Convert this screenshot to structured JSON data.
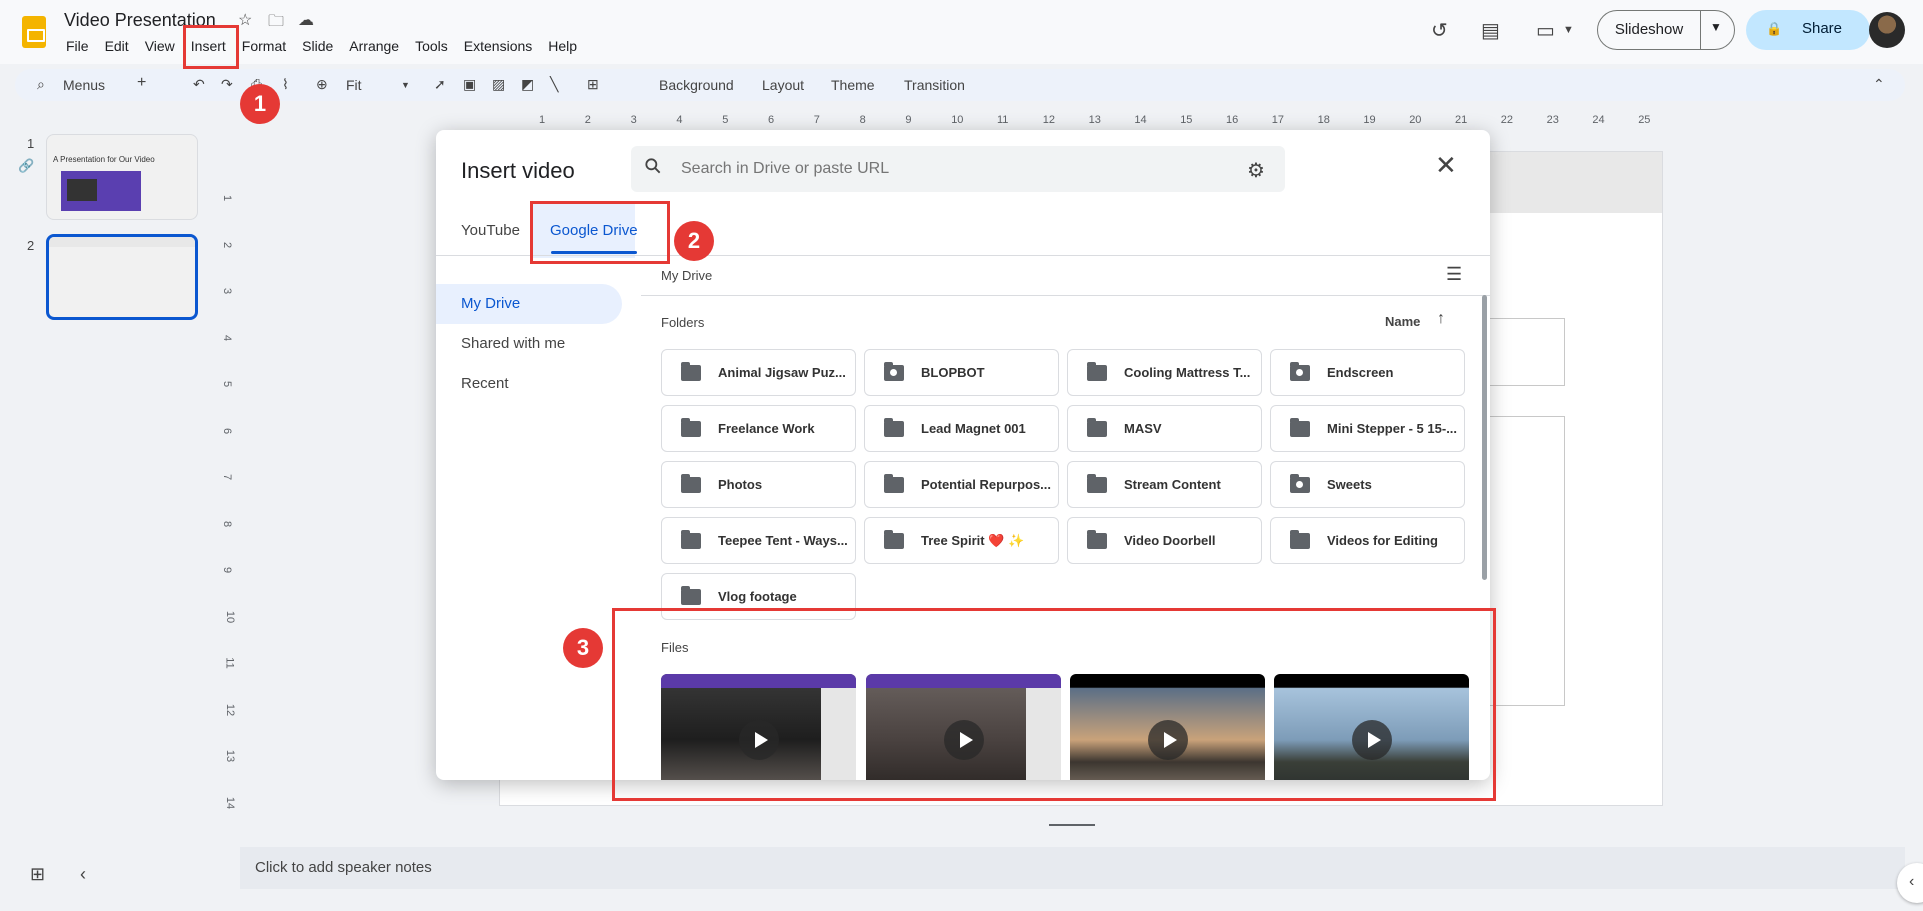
{
  "app": {
    "title": "Video Presentation",
    "menu": [
      "File",
      "Edit",
      "View",
      "Insert",
      "Format",
      "Slide",
      "Arrange",
      "Tools",
      "Extensions",
      "Help"
    ],
    "slideshow_label": "Slideshow",
    "share_label": "Share"
  },
  "toolbar": {
    "menus_label": "Menus",
    "zoom_value": "Fit",
    "background_label": "Background",
    "layout_label": "Layout",
    "theme_label": "Theme",
    "transition_label": "Transition"
  },
  "slides": [
    {
      "number": "1",
      "thumb_title": "A Presentation for Our Video"
    },
    {
      "number": "2"
    }
  ],
  "ruler": {
    "top": [
      "1",
      "2",
      "3",
      "4",
      "5",
      "6",
      "7",
      "8",
      "9",
      "10",
      "11",
      "12",
      "13",
      "14",
      "15",
      "16",
      "17",
      "18",
      "19",
      "20",
      "21",
      "22",
      "23",
      "24",
      "25"
    ],
    "left": [
      "1",
      "2",
      "3",
      "4",
      "5",
      "6",
      "7",
      "8",
      "9",
      "10",
      "11",
      "12",
      "13",
      "14"
    ]
  },
  "speaker_notes": "Click to add speaker notes",
  "dialog": {
    "title": "Insert video",
    "search_placeholder": "Search in Drive or paste URL",
    "tabs": [
      "YouTube",
      "Google Drive"
    ],
    "nav": [
      "My Drive",
      "Shared with me",
      "Recent"
    ],
    "breadcrumb": "My Drive",
    "folders_label": "Folders",
    "sort_label": "Name",
    "files_label": "Files",
    "folders": [
      {
        "name": "Animal Jigsaw Puz...",
        "shared": false
      },
      {
        "name": "BLOPBOT",
        "shared": true
      },
      {
        "name": "Cooling Mattress T...",
        "shared": false
      },
      {
        "name": "Endscreen",
        "shared": true
      },
      {
        "name": "Freelance Work",
        "shared": false
      },
      {
        "name": "Lead Magnet 001",
        "shared": false
      },
      {
        "name": "MASV",
        "shared": false
      },
      {
        "name": "Mini Stepper - 5 15-...",
        "shared": false
      },
      {
        "name": "Photos",
        "shared": false
      },
      {
        "name": "Potential Repurpos...",
        "shared": false
      },
      {
        "name": "Stream Content",
        "shared": false
      },
      {
        "name": "Sweets",
        "shared": true
      },
      {
        "name": "Teepee Tent - Ways...",
        "shared": false
      },
      {
        "name": "Tree Spirit ❤️ ✨",
        "shared": false
      },
      {
        "name": "Video Doorbell",
        "shared": false
      },
      {
        "name": "Videos for Editing",
        "shared": false
      },
      {
        "name": "Vlog footage",
        "shared": false
      }
    ]
  },
  "annotations": [
    "1",
    "2",
    "3"
  ],
  "colors": {
    "accent": "#0b57d0",
    "annotation": "#e53935",
    "share_bg": "#c2e7ff"
  }
}
